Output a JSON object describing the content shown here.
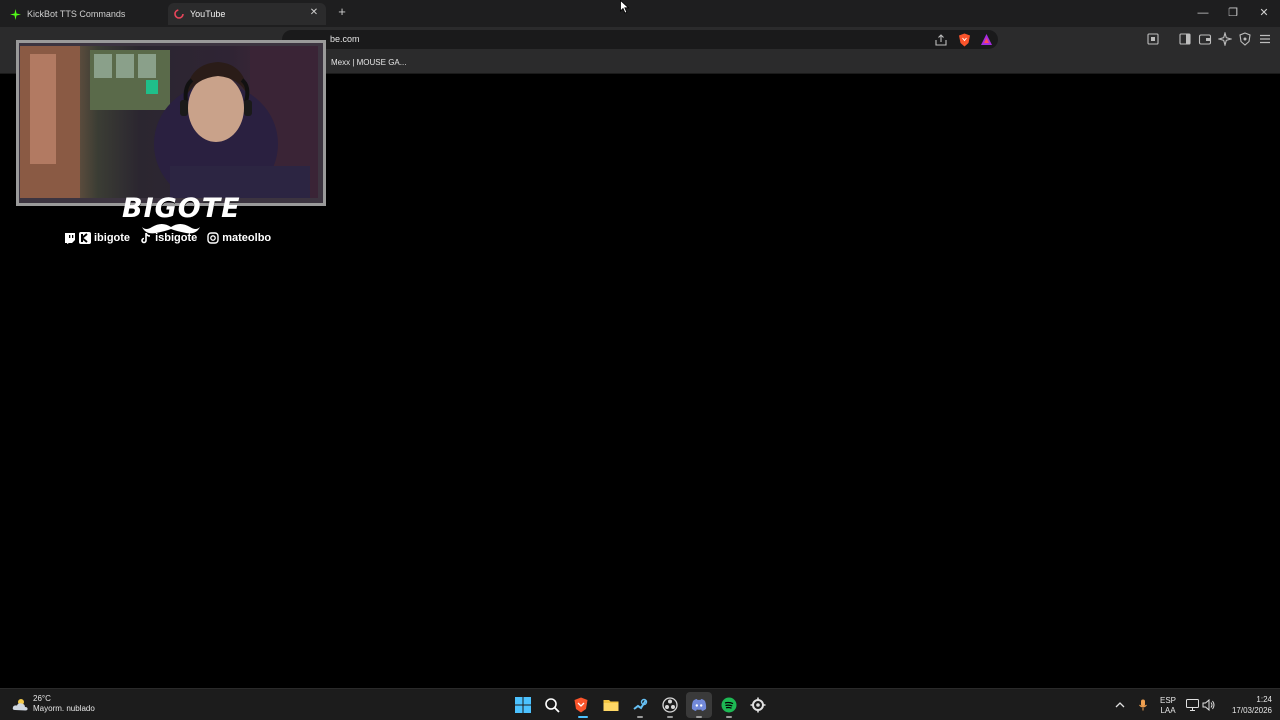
{
  "browser": {
    "tabs": [
      {
        "label": "KickBot TTS Commands",
        "icon": "kick-logo-icon",
        "active": false
      },
      {
        "label": "YouTube",
        "icon": "loading-spinner-icon",
        "active": true
      }
    ],
    "url": "be.com",
    "bookmark": "Mexx | MOUSE GA..."
  },
  "overlay": {
    "logo": "BIGOTE",
    "socials": [
      {
        "icon": "twitch-kick-icon",
        "handle": "ibigote"
      },
      {
        "icon": "tiktok-icon",
        "handle": "isbigote"
      },
      {
        "icon": "instagram-icon",
        "handle": "mateolbo"
      }
    ]
  },
  "taskbar": {
    "weather": {
      "temp": "26°C",
      "condition": "Mayorm. nublado"
    },
    "language": {
      "code": "ESP",
      "layout": "LAA"
    },
    "clock": {
      "time": "1:24",
      "date": "17/03/2026"
    }
  },
  "colors": {
    "accent": "#7289da",
    "spotify": "#1db954",
    "brave": "#fb542b"
  }
}
